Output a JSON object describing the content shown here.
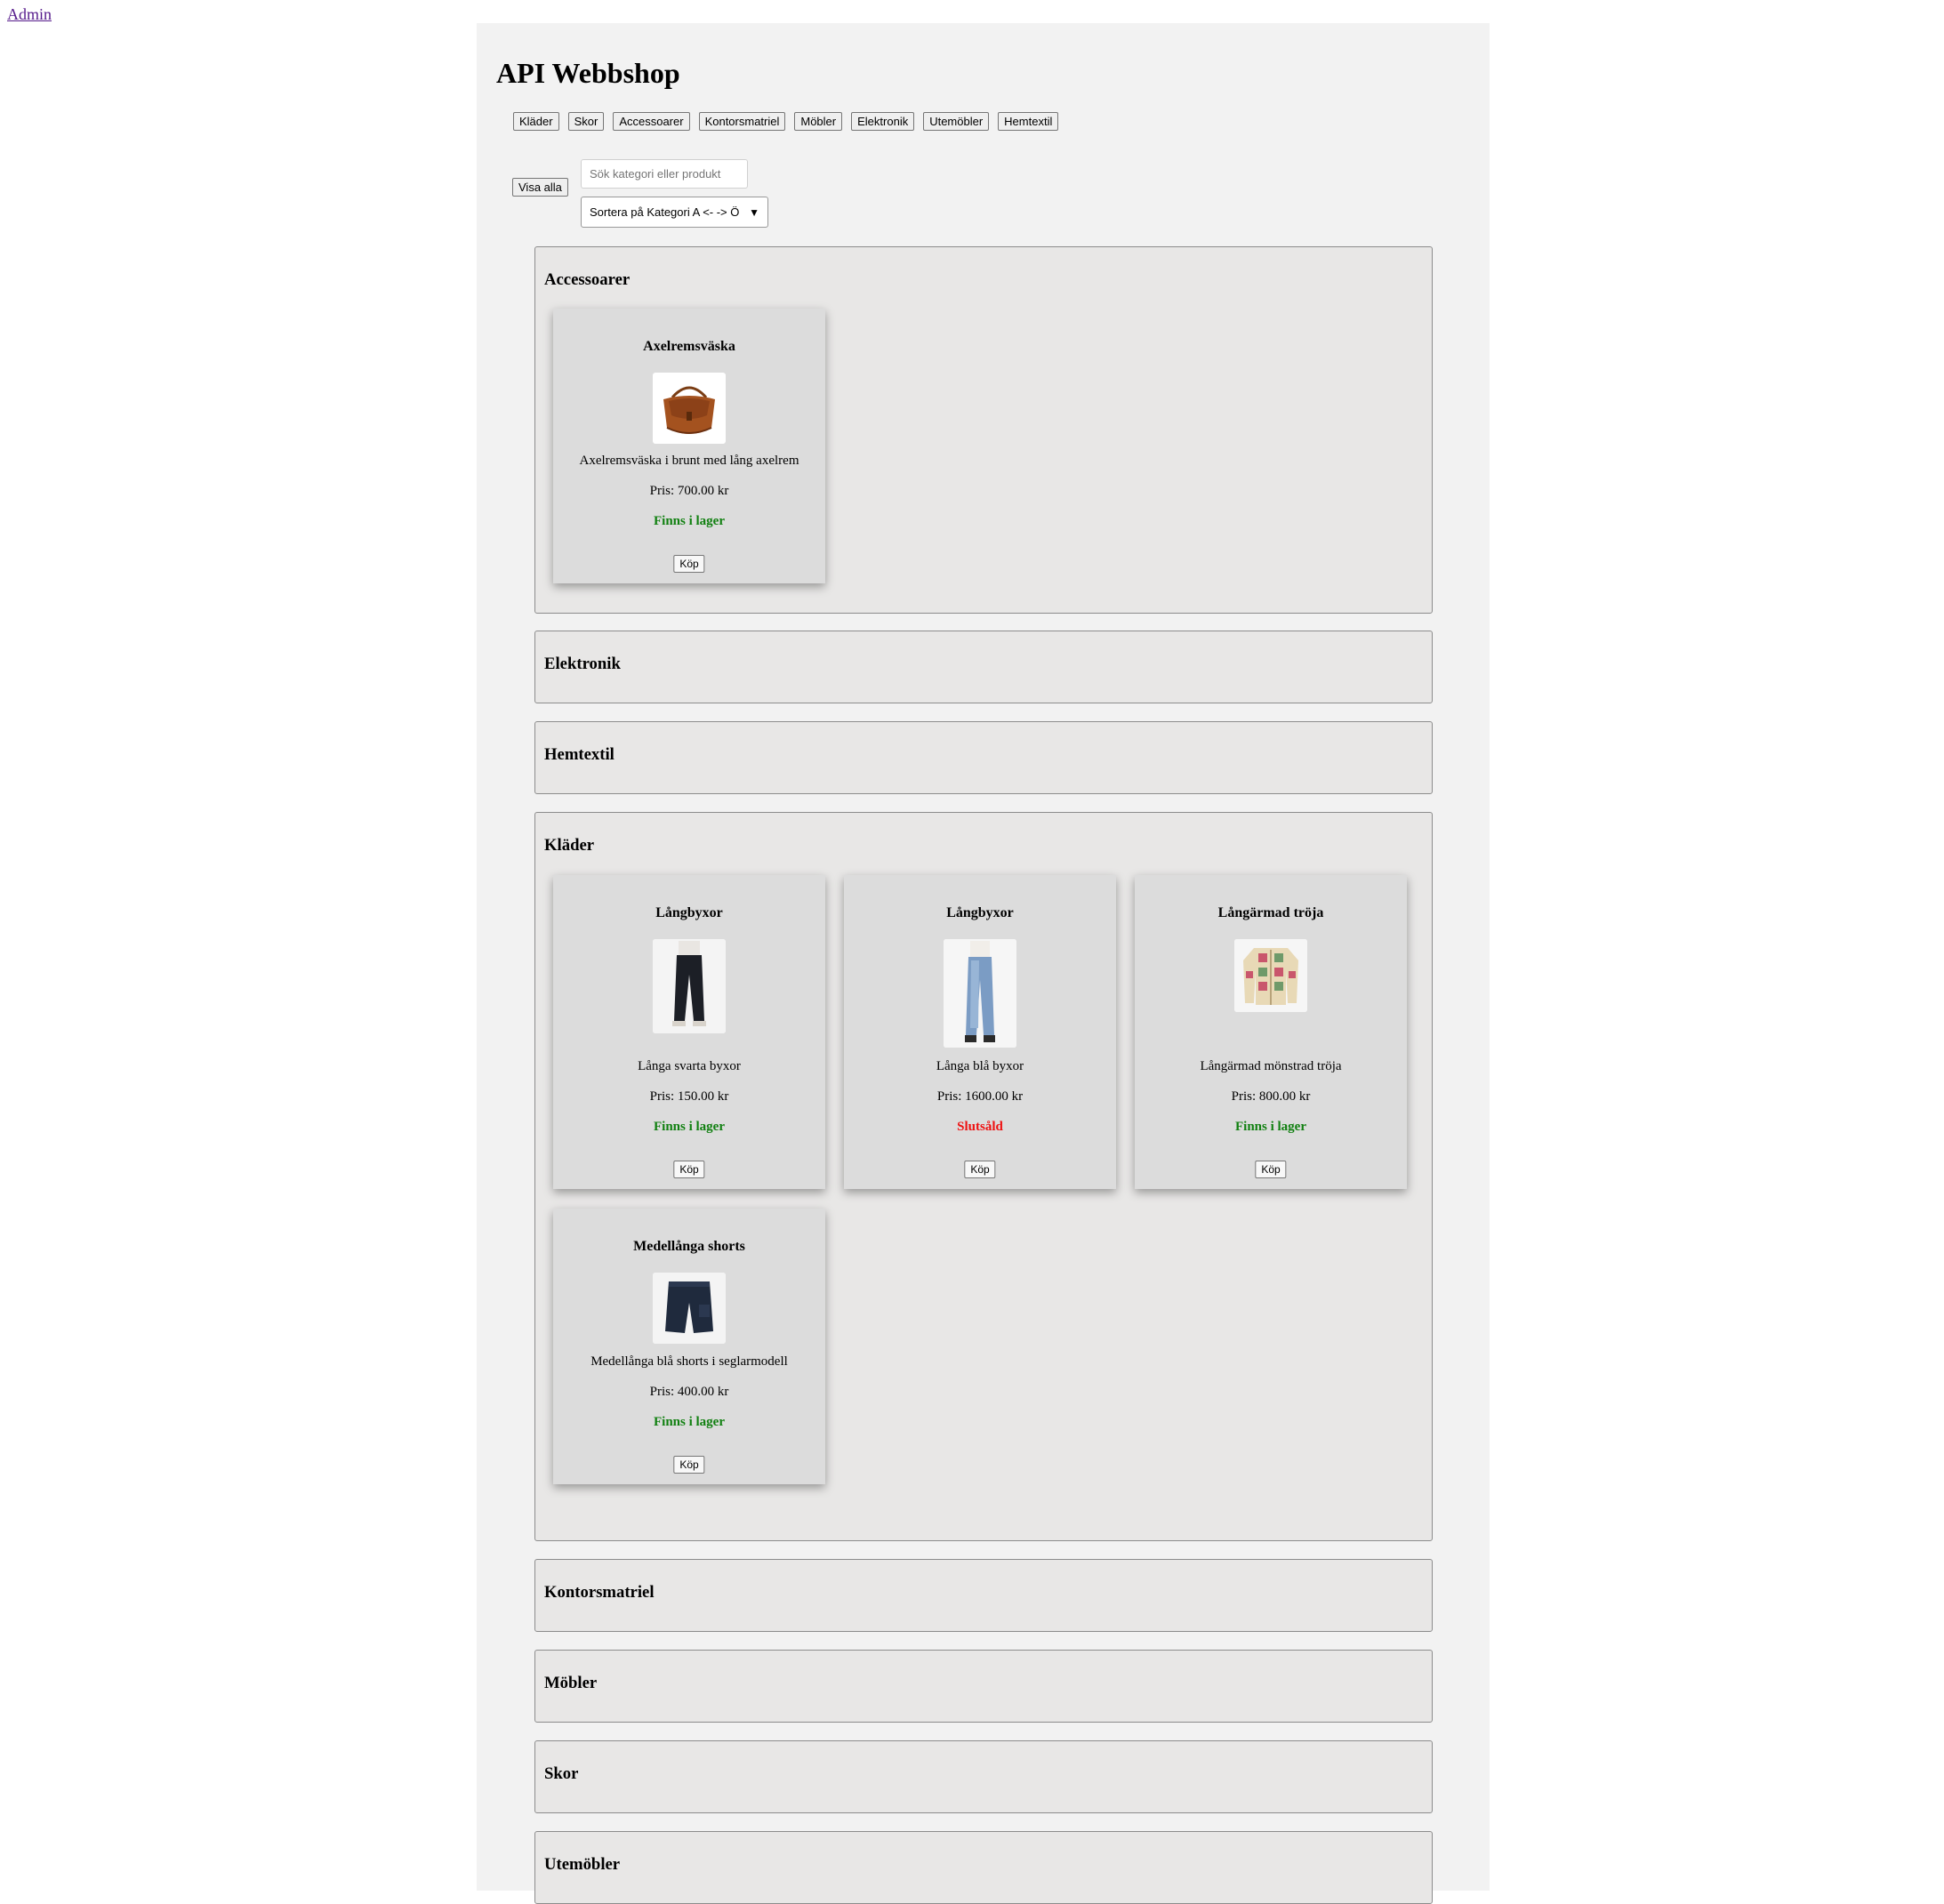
{
  "admin_link": "Admin",
  "title": "API Webbshop",
  "category_buttons": [
    "Kläder",
    "Skor",
    "Accessoarer",
    "Kontorsmatriel",
    "Möbler",
    "Elektronik",
    "Utemöbler",
    "Hemtextil"
  ],
  "controls": {
    "show_all": "Visa alla",
    "search_placeholder": "Sök kategori eller produkt",
    "sort_selected": "Sortera på Kategori A <- -> Ö"
  },
  "sections": [
    {
      "name": "Accessoarer",
      "products": [
        {
          "name": "Axelremsväska",
          "description": "Axelremsväska i brunt med lång axelrem",
          "price": "Pris: 700.00 kr",
          "stock": "Finns i lager",
          "buy": "Köp",
          "image": "brown-leather-bag-image"
        }
      ]
    },
    {
      "name": "Elektronik",
      "products": []
    },
    {
      "name": "Hemtextil",
      "products": []
    },
    {
      "name": "Kläder",
      "products": [
        {
          "name": "Långbyxor",
          "description": "Långa svarta byxor",
          "price": "Pris: 150.00 kr",
          "stock": "Finns i lager",
          "buy": "Köp",
          "image": "black-trousers-image"
        },
        {
          "name": "Långbyxor",
          "description": "Långa blå byxor",
          "price": "Pris: 1600.00 kr",
          "stock": "Slutsåld",
          "buy": "Köp",
          "image": "blue-jeans-image"
        },
        {
          "name": "Långärmad tröja",
          "description": "Långärmad mönstrad tröja",
          "price": "Pris: 800.00 kr",
          "stock": "Finns i lager",
          "buy": "Köp",
          "image": "patterned-cardigan-image"
        },
        {
          "name": "Medellånga shorts",
          "description": "Medellånga blå shorts i seglarmodell",
          "price": "Pris: 400.00 kr",
          "stock": "Finns i lager",
          "buy": "Köp",
          "image": "navy-shorts-image"
        }
      ]
    },
    {
      "name": "Kontorsmatriel",
      "products": []
    },
    {
      "name": "Möbler",
      "products": []
    },
    {
      "name": "Skor",
      "products": []
    },
    {
      "name": "Utemöbler",
      "products": []
    }
  ],
  "colors": {
    "in_stock": "#118011",
    "sold_out": "#ee1111",
    "panel_background": "#f2f2f2",
    "section_background": "#e8e7e6",
    "card_background": "#dcdcdc"
  }
}
